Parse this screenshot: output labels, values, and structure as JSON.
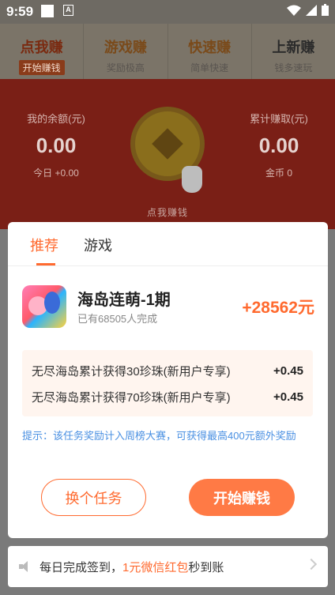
{
  "status_bar": {
    "time": "9:59",
    "a_badge": "A"
  },
  "top_tabs": [
    {
      "title": "点我赚",
      "subtitle": "开始赚钱"
    },
    {
      "title": "游戏赚",
      "subtitle": "奖励极高"
    },
    {
      "title": "快速赚",
      "subtitle": "简单快速"
    },
    {
      "title": "上新赚",
      "subtitle": "钱多速玩"
    }
  ],
  "hero": {
    "balance_label": "我的余额(元)",
    "balance_value": "0.00",
    "today": "今日 +0.00",
    "total_label": "累计赚取(元)",
    "total_value": "0.00",
    "coins": "金币 0",
    "click_label": "点我赚钱"
  },
  "modal": {
    "tabs": [
      "推荐",
      "游戏"
    ],
    "game_name": "海岛连萌-1期",
    "game_done": "已有68505人完成",
    "reward": "+28562元",
    "tasks": [
      {
        "desc": "无尽海岛累计获得30珍珠(新用户专享)",
        "amount": "+0.45"
      },
      {
        "desc": "无尽海岛累计获得70珍珠(新用户专享)",
        "amount": "+0.45"
      }
    ],
    "tip": "提示：该任务奖励计入周榜大赛，可获得最高400元额外奖励",
    "change_button": "换个任务",
    "start_button": "开始赚钱"
  },
  "notice": {
    "prefix": "每日完成签到，",
    "highlight": "1元微信红包",
    "suffix": "秒到账"
  },
  "colors": {
    "accent": "#ff6a2f",
    "tip": "#4a90e2"
  }
}
